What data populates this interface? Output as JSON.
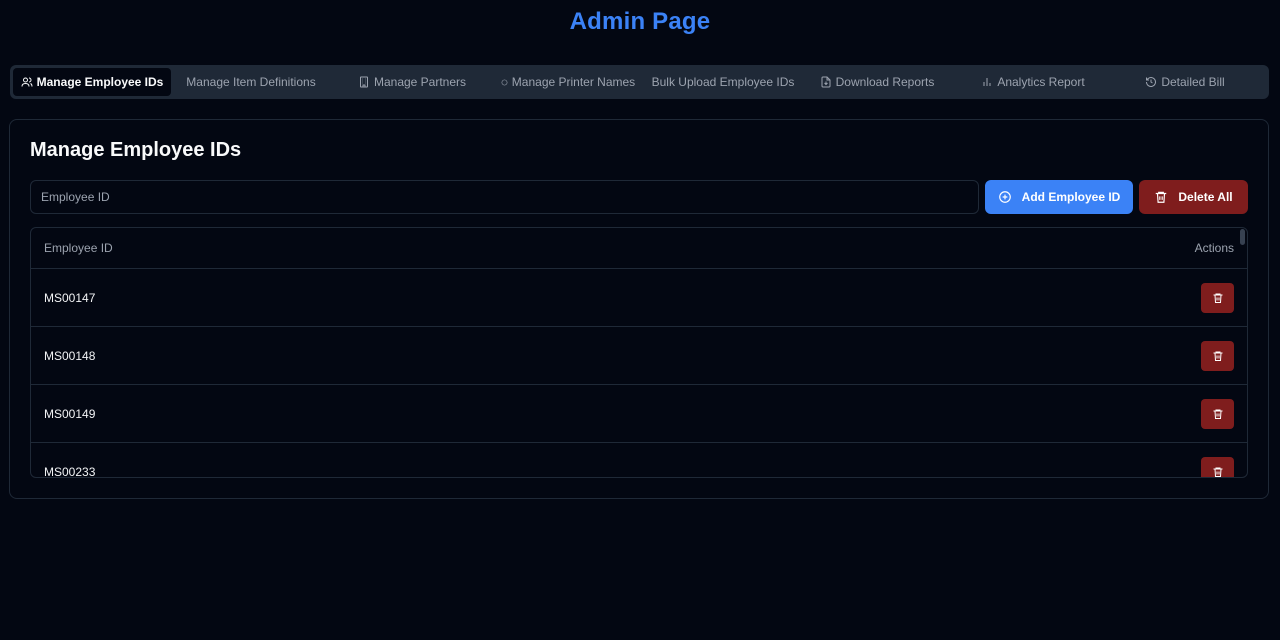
{
  "header": {
    "title": "Admin Page"
  },
  "tabs": [
    {
      "label": "Manage Employee IDs",
      "icon": "users-icon",
      "active": true
    },
    {
      "label": "Manage Item Definitions",
      "icon": "",
      "active": false
    },
    {
      "label": "Manage Partners",
      "icon": "building-icon",
      "active": false
    },
    {
      "label": "Manage Printer Names",
      "icon": "printer-icon",
      "active": false
    },
    {
      "label": "Bulk Upload Employee IDs",
      "icon": "",
      "active": false
    },
    {
      "label": "Download Reports",
      "icon": "file-download-icon",
      "active": false
    },
    {
      "label": "Analytics Report",
      "icon": "bar-chart-icon",
      "active": false
    },
    {
      "label": "Detailed Bill",
      "icon": "history-icon",
      "active": false
    }
  ],
  "main": {
    "title": "Manage Employee IDs",
    "input_placeholder": "Employee ID",
    "input_value": "",
    "add_button_label": "Add Employee ID",
    "delete_all_label": "Delete All",
    "table": {
      "columns": [
        "Employee ID",
        "Actions"
      ],
      "rows": [
        {
          "employee_id": "MS00147"
        },
        {
          "employee_id": "MS00148"
        },
        {
          "employee_id": "MS00149"
        },
        {
          "employee_id": "MS00233"
        }
      ]
    }
  },
  "colors": {
    "accent": "#3b82f6",
    "danger": "#7f1d1d",
    "background": "#030712"
  }
}
